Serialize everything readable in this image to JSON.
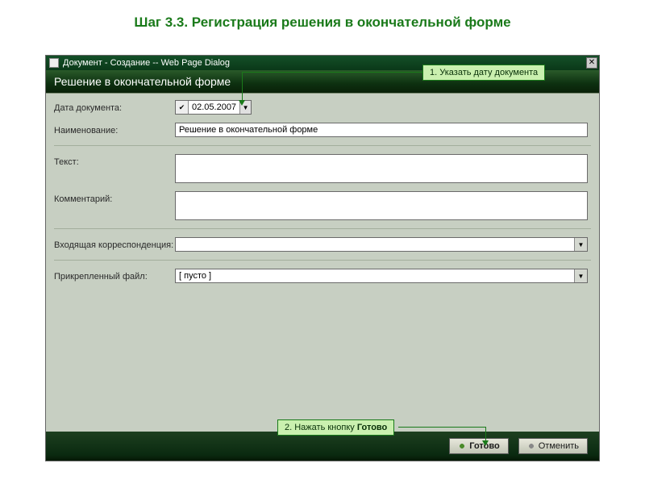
{
  "page": {
    "step_title": "Шаг 3.3. Регистрация решения в окончательной форме"
  },
  "dialog": {
    "window_title": "Документ - Создание -- Web Page Dialog",
    "subtitle": "Решение в окончательной форме"
  },
  "form": {
    "date_label": "Дата документа:",
    "date_value": "02.05.2007",
    "name_label": "Наименование:",
    "name_value": "Решение в окончательной форме",
    "text_label": "Текст:",
    "text_value": "",
    "comment_label": "Комментарий:",
    "comment_value": "",
    "incoming_label": "Входящая корреспонденция:",
    "incoming_value": "",
    "file_label": "Прикрепленный файл:",
    "file_value": "[ пусто ]"
  },
  "footer": {
    "ok_label": "Готово",
    "cancel_label": "Отменить"
  },
  "callouts": {
    "c1": "1. Указать дату документа",
    "c2_pre": "2. Нажать кнопку ",
    "c2_bold": "Готово"
  }
}
